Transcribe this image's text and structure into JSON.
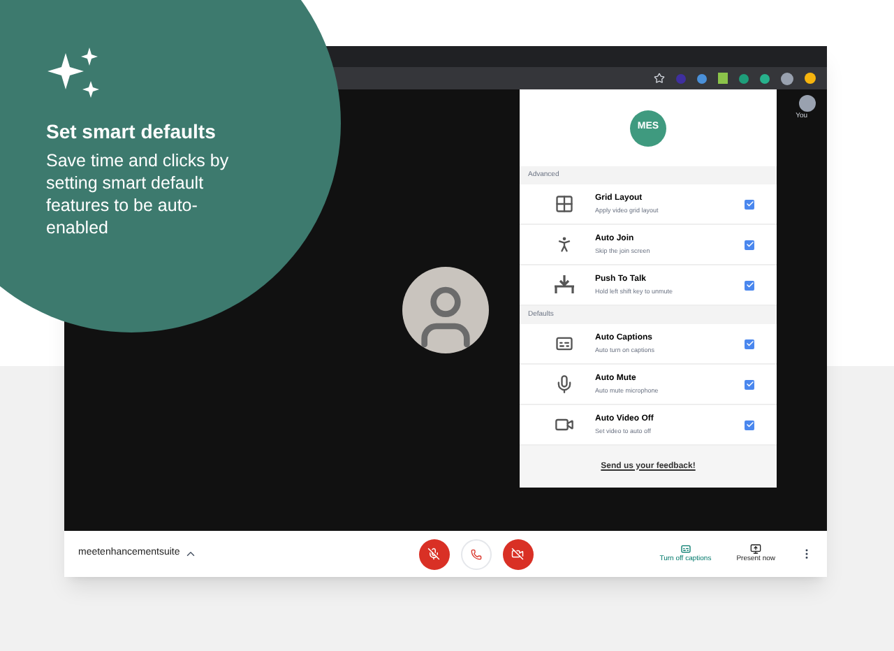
{
  "promo": {
    "title": "Set smart defaults",
    "text": "Save time and clicks by setting smart default features to be auto-enabled"
  },
  "participant": {
    "label": "You"
  },
  "panel": {
    "logo": "MES",
    "sections": [
      {
        "label": "Advanced",
        "items": [
          {
            "title": "Grid Layout",
            "subtitle": "Apply video grid layout",
            "checked": true
          },
          {
            "title": "Auto Join",
            "subtitle": "Skip the join screen",
            "checked": true
          },
          {
            "title": "Push To Talk",
            "subtitle": "Hold left shift key to unmute",
            "checked": true
          }
        ]
      },
      {
        "label": "Defaults",
        "items": [
          {
            "title": "Auto Captions",
            "subtitle": "Auto turn on captions",
            "checked": true
          },
          {
            "title": "Auto Mute",
            "subtitle": "Auto mute microphone",
            "checked": true
          },
          {
            "title": "Auto Video Off",
            "subtitle": "Set video to auto off",
            "checked": true
          }
        ]
      }
    ],
    "feedback": "Send us your feedback!"
  },
  "bottom_bar": {
    "meeting_name": "meetenhancementsuite",
    "captions_button": "Turn off captions",
    "present_button": "Present now"
  }
}
